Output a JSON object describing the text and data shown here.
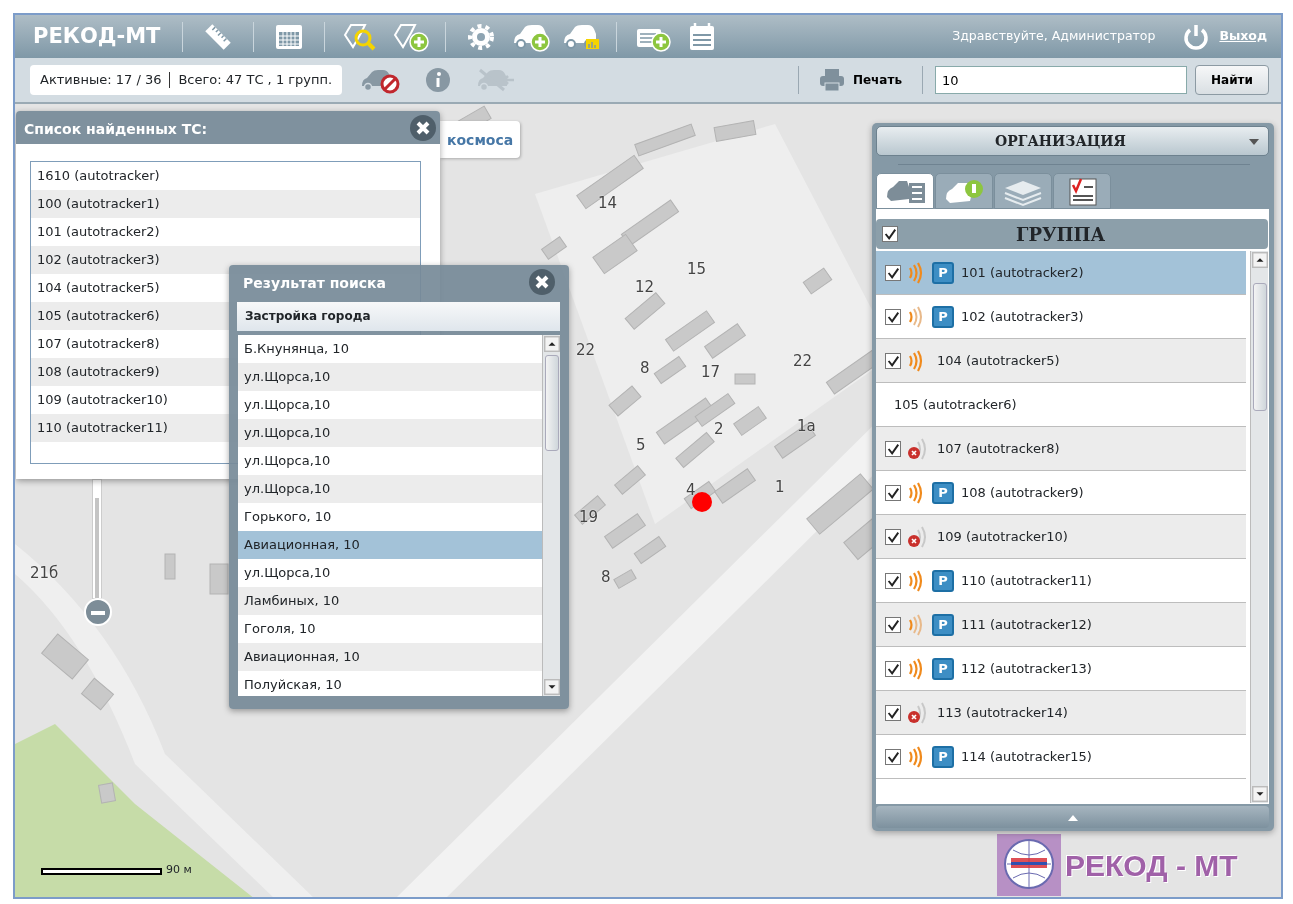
{
  "header": {
    "title": "РЕКОД-МТ",
    "greeting": "Здравствуйте, Администратор",
    "logout": "Выход"
  },
  "toolbar": {
    "active": "Активные: 17 / 36",
    "total": "Всего: 47 ТС , 1 групп.",
    "print": "Печать",
    "search_value": "10",
    "search_button": "Найти"
  },
  "map": {
    "layer_tab": "космоса",
    "zoom": {
      "level": 0.85
    },
    "labels": [
      "14",
      "15",
      "12",
      "22",
      "8",
      "17",
      "22",
      "5",
      "2",
      "1а",
      "4",
      "1",
      "19",
      "8",
      "21б"
    ],
    "scale": "90 м",
    "logo": "РЕКОД - МТ"
  },
  "found_window": {
    "title": "Список найденных ТС:",
    "items": [
      "1610 (autotracker)",
      "100 (autotracker1)",
      "101 (autotracker2)",
      "102 (autotracker3)",
      "104 (autotracker5)",
      "105 (autotracker6)",
      "107 (autotracker8)",
      "108 (autotracker9)",
      "109 (autotracker10)",
      "110 (autotracker11)"
    ]
  },
  "search_window": {
    "title": "Результат поиска",
    "column": "Застройка города",
    "results": [
      {
        "text": "Б.Кнунянца, 10",
        "selected": false
      },
      {
        "text": "ул.Щорса,10",
        "selected": false
      },
      {
        "text": "ул.Щорса,10",
        "selected": false
      },
      {
        "text": "ул.Щорса,10",
        "selected": false
      },
      {
        "text": "ул.Щорса,10",
        "selected": false
      },
      {
        "text": "ул.Щорса,10",
        "selected": false
      },
      {
        "text": "Горького, 10",
        "selected": false
      },
      {
        "text": "Авиационная, 10",
        "selected": true
      },
      {
        "text": "ул.Щорса,10",
        "selected": false
      },
      {
        "text": "Ламбиных, 10",
        "selected": false
      },
      {
        "text": "Гоголя, 10",
        "selected": false
      },
      {
        "text": "Авиационная, 10",
        "selected": false
      },
      {
        "text": "Полуйская, 10",
        "selected": false
      }
    ]
  },
  "panel": {
    "organization": "ОРГАНИЗАЦИЯ",
    "tabs": [
      {
        "selected": true
      },
      {
        "selected": false
      },
      {
        "selected": false
      },
      {
        "selected": false
      }
    ],
    "group": {
      "title": "ГРУППА",
      "checked": true
    },
    "vehicles": [
      {
        "name": "101 (autotracker2)",
        "kind": "tracked",
        "checked": true,
        "online": true,
        "strong_signal": true,
        "badge": "P",
        "selected": true
      },
      {
        "name": "102 (autotracker3)",
        "kind": "tracked",
        "checked": true,
        "online": true,
        "strong_signal": false,
        "badge": "P",
        "selected": false
      },
      {
        "name": "104 (autotracker5)",
        "kind": "tracked",
        "checked": true,
        "online": true,
        "strong_signal": true,
        "selected": false
      },
      {
        "name": "105 (autotracker6)",
        "kind": "untracked",
        "selected": false
      },
      {
        "name": "107 (autotracker8)",
        "kind": "tracked",
        "checked": true,
        "online": false,
        "selected": false
      },
      {
        "name": "108 (autotracker9)",
        "kind": "tracked",
        "checked": true,
        "online": true,
        "strong_signal": true,
        "badge": "P",
        "selected": false
      },
      {
        "name": "109 (autotracker10)",
        "kind": "tracked",
        "checked": true,
        "online": false,
        "selected": false
      },
      {
        "name": "110 (autotracker11)",
        "kind": "tracked",
        "checked": true,
        "online": true,
        "strong_signal": true,
        "badge": "P",
        "selected": false
      },
      {
        "name": "111 (autotracker12)",
        "kind": "tracked",
        "checked": true,
        "online": true,
        "strong_signal": false,
        "badge": "P",
        "selected": false
      },
      {
        "name": "112 (autotracker13)",
        "kind": "tracked",
        "checked": true,
        "online": true,
        "strong_signal": true,
        "badge": "P",
        "selected": false
      },
      {
        "name": "113 (autotracker14)",
        "kind": "tracked",
        "checked": true,
        "online": false,
        "selected": false
      },
      {
        "name": "114 (autotracker15)",
        "kind": "tracked",
        "checked": true,
        "online": true,
        "strong_signal": true,
        "badge": "P",
        "selected": false
      }
    ]
  }
}
